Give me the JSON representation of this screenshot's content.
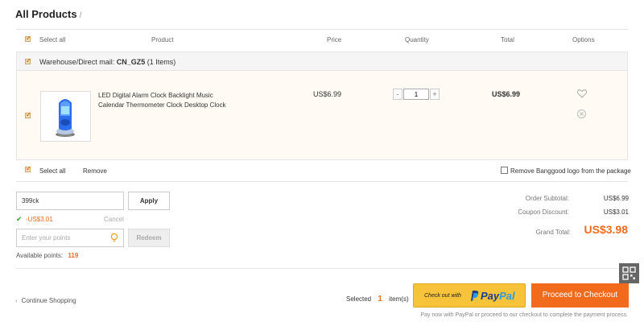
{
  "page_title": "All Products",
  "page_title_sep": "/",
  "table_headers": {
    "select_all": "Select all",
    "product": "Product",
    "price": "Price",
    "quantity": "Quantity",
    "total": "Total",
    "options": "Options"
  },
  "warehouse": {
    "prefix": "Warehouse/Direct mail:",
    "code": "CN_GZ5",
    "count": "(1 Items)"
  },
  "item": {
    "title_line1": "LED Digital Alarm Clock Backlight Music",
    "title_line2": "Calendar Thermometer Clock Desktop Clock",
    "price": "US$6.99",
    "quantity": "1",
    "total": "US$6.99",
    "qty_minus": "-",
    "qty_plus": "+"
  },
  "footer_bar": {
    "select_all": "Select all",
    "remove": "Remove",
    "remove_logo": "Remove Banggood logo from the package"
  },
  "coupon": {
    "value": "399ck",
    "apply": "Apply",
    "discount": "-US$3.01",
    "cancel": "Cancel"
  },
  "points": {
    "placeholder": "Enter your points",
    "redeem": "Redeem",
    "available_label": "Available points:",
    "available_value": "119"
  },
  "summary": {
    "subtotal_label": "Order Subtotal:",
    "subtotal_value": "US$6.99",
    "coupon_label": "Coupon Discount:",
    "coupon_value": "US$3.01",
    "grand_label": "Grand Total:",
    "grand_value": "US$3.98"
  },
  "bottom": {
    "continue": "Continue Shopping",
    "selected_label": "Selected",
    "selected_count": "1",
    "selected_suffix": "item(s)",
    "paypal_prefix": "Check out with",
    "paypal_brand_pay": "Pay",
    "paypal_brand_pal": "Pal",
    "checkout": "Proceed to Checkout",
    "note": "Pay now with PayPal or proceed to our checkout to complete the payment process."
  },
  "colors": {
    "accent": "#f26b1d",
    "paypal_yellow": "#f7c33a",
    "points_orange": "#f26b1d"
  }
}
